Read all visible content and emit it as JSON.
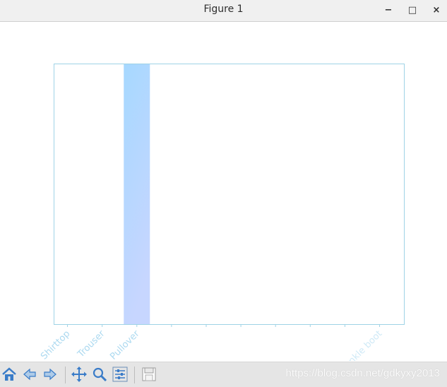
{
  "window": {
    "title": "Figure 1"
  },
  "window_controls": {
    "minimize": "−",
    "maximize": "□",
    "close": "×"
  },
  "toolbar": {
    "buttons": [
      "home-icon",
      "back-icon",
      "forward-icon",
      "pan-icon",
      "zoom-icon",
      "subplots-icon",
      "save-icon"
    ]
  },
  "watermark": "https://blog.csdn.net/gdkyxy2013",
  "colors": {
    "axes_edge": "#9fd3e6",
    "bar_top": "#a6d8ff",
    "bar_bottom": "#c7d6ff",
    "tick_label": "#a8d8f0",
    "toolbar_icon": "#3a7cc8"
  },
  "chart_data": {
    "type": "bar",
    "categories": [
      "Shirttop",
      "Trouser",
      "Pullover",
      "",
      "",
      "",
      "",
      "",
      "",
      "Ankle boot"
    ],
    "values": [
      0,
      0,
      1,
      0,
      0,
      0,
      0,
      0,
      0,
      0
    ],
    "ylim": [
      0,
      1
    ],
    "grid": false,
    "legend": "none"
  }
}
